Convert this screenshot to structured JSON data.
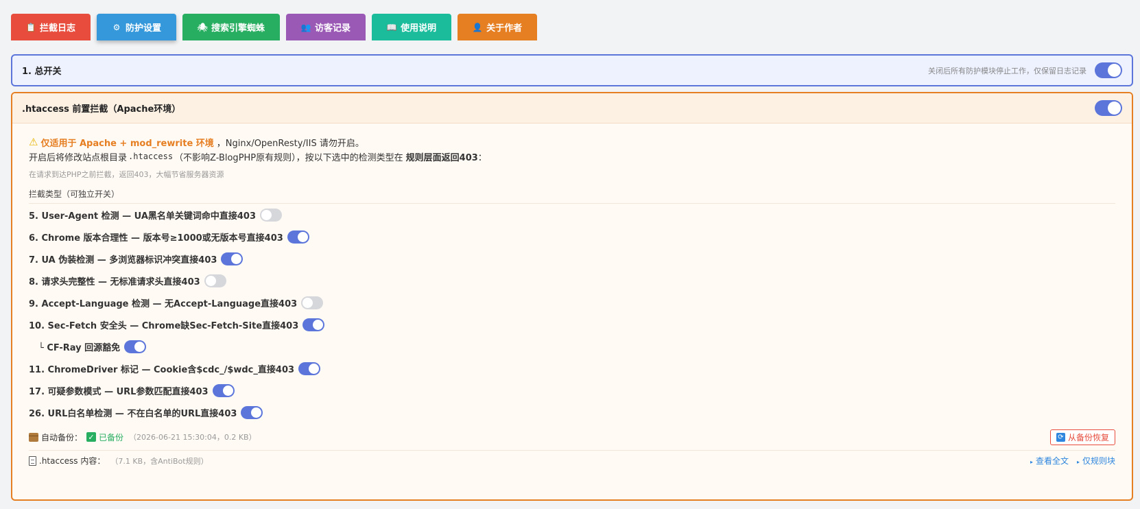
{
  "tabs": [
    {
      "label": "拦截日志",
      "icon": "clipboard-icon",
      "color": "#e74c3c",
      "active": false
    },
    {
      "label": "防护设置",
      "icon": "gear-icon",
      "color": "#3498db",
      "active": true
    },
    {
      "label": "搜索引擎蜘蛛",
      "icon": "bug-icon",
      "color": "#27ae60",
      "active": false
    },
    {
      "label": "访客记录",
      "icon": "users-icon",
      "color": "#9b59b6",
      "active": false
    },
    {
      "label": "使用说明",
      "icon": "book-icon",
      "color": "#1abc9c",
      "active": false
    },
    {
      "label": "关于作者",
      "icon": "person-icon",
      "color": "#e67e22",
      "active": false
    }
  ],
  "master": {
    "title": "1. 总开关",
    "hint": "关闭后所有防护模块停止工作，仅保留日志记录",
    "enabled": true
  },
  "htaccess": {
    "title": ".htaccess 前置拦截（Apache环境）",
    "enabled": true,
    "warning_icon": "⚠",
    "warning_highlight": "仅适用于 Apache + mod_rewrite 环境",
    "warning_rest": "，Nginx/OpenResty/IIS 请勿开启。",
    "desc_prefix": "开启后将修改站点根目录",
    "desc_code": ".htaccess",
    "desc_middle": "（不影响Z-BlogPHP原有规则），按以下选中的检测类型在",
    "desc_bold": "规则层面返回403",
    "desc_suffix": "：",
    "hint": "在请求到达PHP之前拦截，返回403，大幅节省服务器资源",
    "section_label": "拦截类型（可独立开关）",
    "rules": [
      {
        "label": "5. User-Agent 检测 — UA黑名单关键词命中直接403",
        "enabled": false,
        "sub": false
      },
      {
        "label": "6. Chrome 版本合理性 — 版本号≥1000或无版本号直接403",
        "enabled": true,
        "sub": false
      },
      {
        "label": "7. UA 伪装检测 — 多浏览器标识冲突直接403",
        "enabled": true,
        "sub": false
      },
      {
        "label": "8. 请求头完整性 — 无标准请求头直接403",
        "enabled": false,
        "sub": false
      },
      {
        "label": "9. Accept-Language 检测 — 无Accept-Language直接403",
        "enabled": false,
        "sub": false
      },
      {
        "label": "10. Sec-Fetch 安全头 — Chrome缺Sec-Fetch-Site直接403",
        "enabled": true,
        "sub": false
      },
      {
        "label": "└ CF-Ray 回源豁免",
        "enabled": true,
        "sub": true
      },
      {
        "label": "11. ChromeDriver 标记 — Cookie含$cdc_/$wdc_直接403",
        "enabled": true,
        "sub": false
      },
      {
        "label": "17. 可疑参数模式 — URL参数匹配直接403",
        "enabled": true,
        "sub": false
      },
      {
        "label": "26. URL白名单检测 — 不在白名单的URL直接403",
        "enabled": true,
        "sub": false
      }
    ],
    "backup": {
      "label": "自动备份：",
      "status": "已备份",
      "meta": "（2026-06-21 15:30:04，0.2 KB）",
      "restore_label": "从备份恢复"
    },
    "content": {
      "label": ".htaccess 内容：",
      "meta": "（7.1 KB，含AntiBot规则）",
      "view_all": "查看全文",
      "view_rules": "仅规则块"
    }
  }
}
